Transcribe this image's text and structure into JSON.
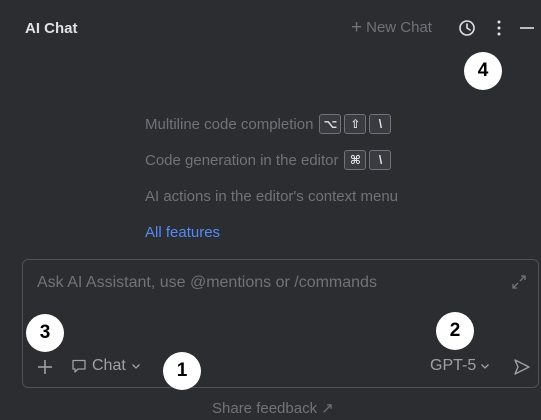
{
  "header": {
    "title": "AI Chat",
    "new_chat_label": "New Chat",
    "icons": [
      "plus-icon",
      "history-icon",
      "more-vertical-icon",
      "minimize-icon"
    ]
  },
  "features": {
    "line1": "Multiline code completion",
    "line1_keys": [
      "⌥",
      "⇧",
      "\\"
    ],
    "line2": "Code generation in the editor",
    "line2_keys": [
      "⌘",
      "\\"
    ],
    "line3": "AI actions in the editor's context menu",
    "link": "All features"
  },
  "input": {
    "placeholder": "Ask AI Assistant, use @mentions or /commands",
    "mode_label": "Chat",
    "model_label": "GPT-5"
  },
  "footer": {
    "feedback": "Share feedback",
    "feedback_arrow": "↗"
  },
  "badges": [
    "1",
    "2",
    "3",
    "4"
  ],
  "colors": {
    "background": "#2b2d30",
    "link": "#548af7",
    "muted_text": "#6f737a",
    "title_text": "#dfe1e5",
    "border": "#4e5157"
  }
}
